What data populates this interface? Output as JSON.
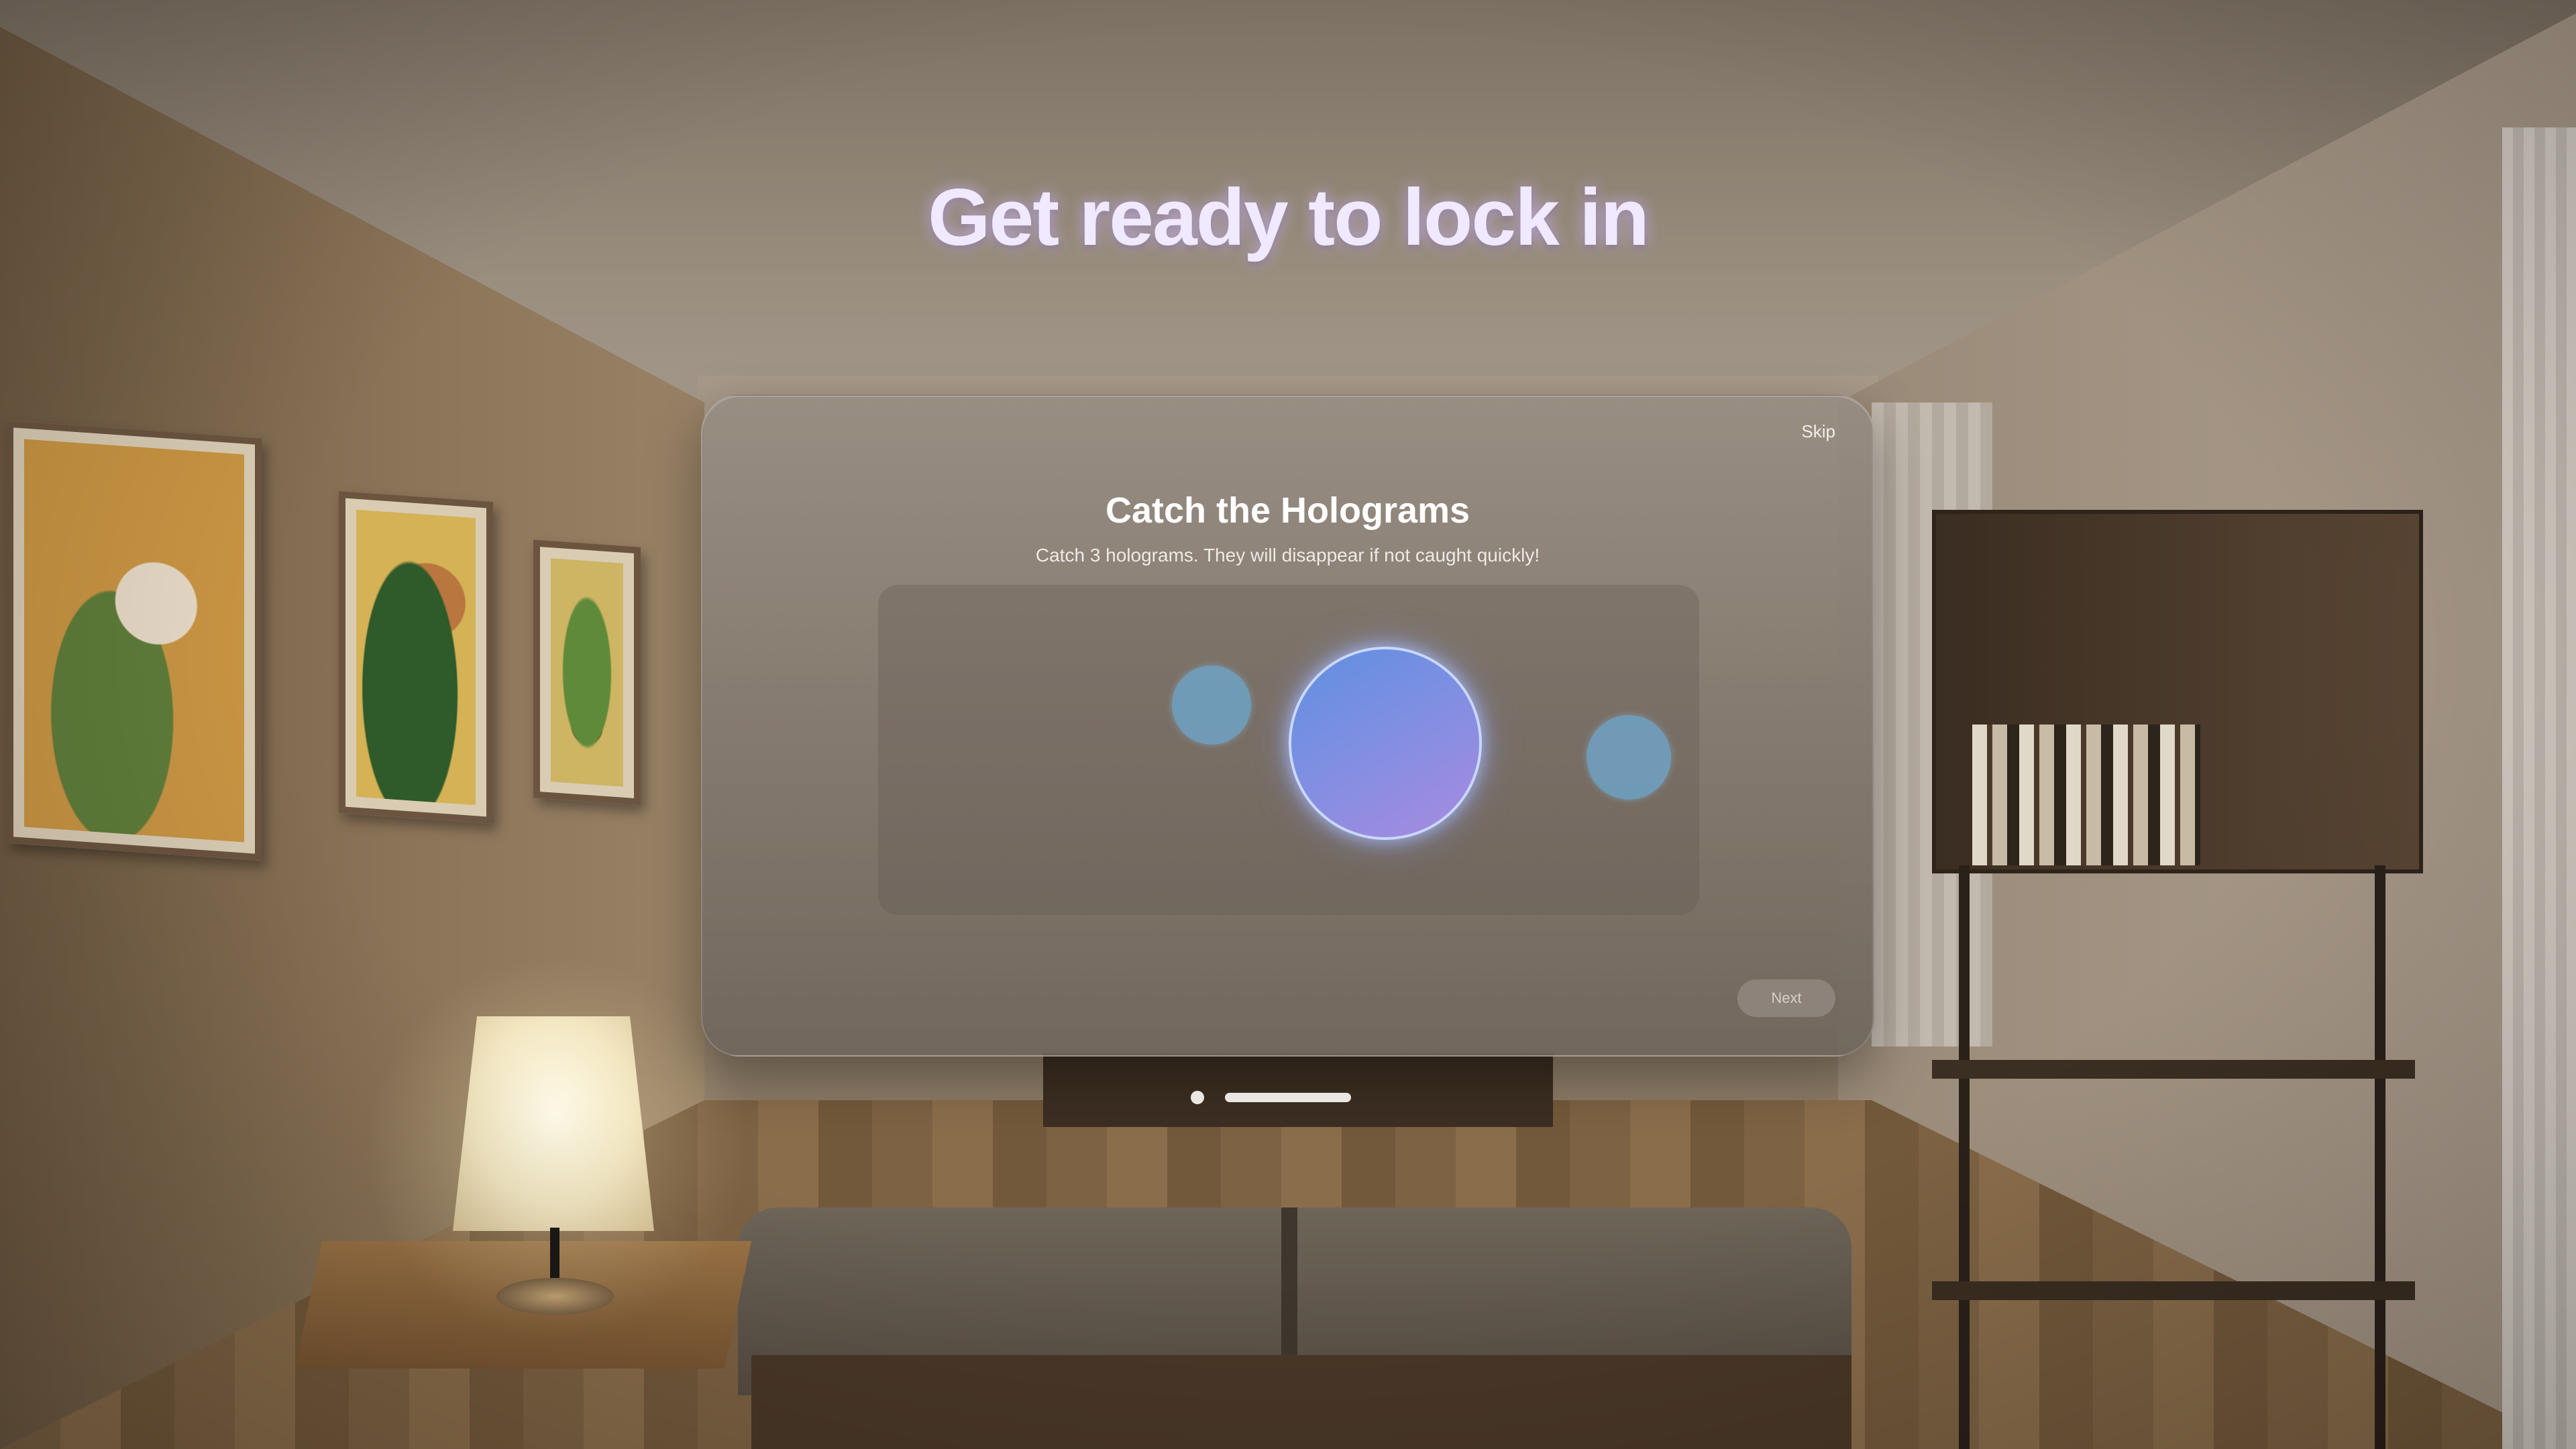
{
  "scene": {
    "headline": "Get ready to lock in"
  },
  "window": {
    "skip_label": "Skip",
    "title": "Catch the Holograms",
    "subtitle": "Catch 3 holograms. They will disappear if not caught quickly!",
    "next_label": "Next",
    "next_enabled": false
  },
  "colors": {
    "headline_glow": "#d2beff",
    "hologram_small": "#6eaad2",
    "hologram_active_start": "#5f8fe0",
    "hologram_active_end": "#a88ae0"
  }
}
